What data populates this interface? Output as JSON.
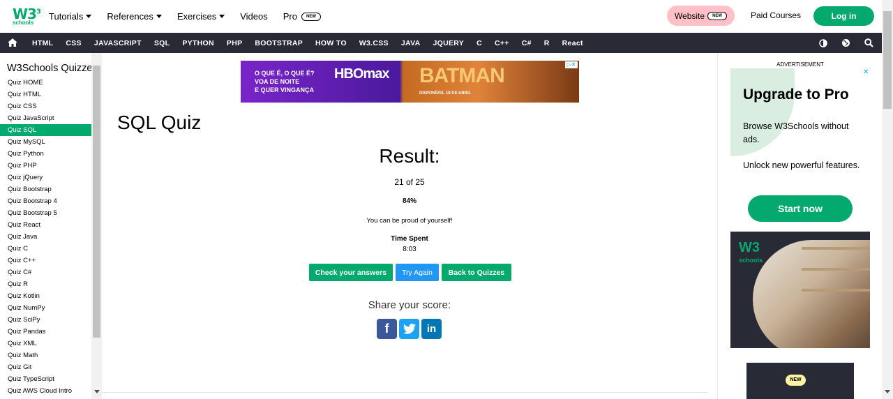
{
  "header": {
    "logo_text": "W3",
    "logo_sup": "3",
    "logo_sub": "schools",
    "nav": [
      {
        "label": "Tutorials",
        "dropdown": true
      },
      {
        "label": "References",
        "dropdown": true
      },
      {
        "label": "Exercises",
        "dropdown": true
      },
      {
        "label": "Videos",
        "dropdown": false
      },
      {
        "label": "Pro",
        "badge": "NEW"
      }
    ],
    "website_label": "Website",
    "website_badge": "NEW",
    "paid_courses": "Paid Courses",
    "login": "Log in"
  },
  "topics": [
    "HTML",
    "CSS",
    "JAVASCRIPT",
    "SQL",
    "PYTHON",
    "PHP",
    "BOOTSTRAP",
    "HOW TO",
    "W3.CSS",
    "JAVA",
    "JQUERY",
    "C",
    "C++",
    "C#",
    "R",
    "React"
  ],
  "sidebar": {
    "title": "W3Schools Quizzes",
    "items": [
      "Quiz HOME",
      "Quiz HTML",
      "Quiz CSS",
      "Quiz JavaScript",
      "Quiz SQL",
      "Quiz MySQL",
      "Quiz Python",
      "Quiz PHP",
      "Quiz jQuery",
      "Quiz Bootstrap",
      "Quiz Bootstrap 4",
      "Quiz Bootstrap 5",
      "Quiz React",
      "Quiz Java",
      "Quiz C",
      "Quiz C++",
      "Quiz C#",
      "Quiz R",
      "Quiz Kotlin",
      "Quiz NumPy",
      "Quiz SciPy",
      "Quiz Pandas",
      "Quiz XML",
      "Quiz Math",
      "Quiz Git",
      "Quiz TypeScript",
      "Quiz AWS Cloud Intro"
    ],
    "active_index": 4
  },
  "ad_banner": {
    "line1": "O QUE É, O QUE É?",
    "line2": "VOA DE NOITE",
    "line3": "E QUER VINGANÇA",
    "brand": "HBOmax",
    "movie": "BATMAN",
    "date": "DISPONÍVEL 18 DE ABRIL"
  },
  "main": {
    "title": "SQL Quiz",
    "result_heading": "Result:",
    "score": "21 of 25",
    "percent": "84%",
    "message": "You can be proud of yourself!",
    "time_label": "Time Spent",
    "time_value": "8:03",
    "buttons": {
      "check": "Check your answers",
      "retry": "Try Again",
      "back": "Back to Quizzes"
    },
    "share_label": "Share your score:"
  },
  "right_ad": {
    "label": "ADVERTISEMENT",
    "heading": "Upgrade to Pro",
    "p1": "Browse W3Schools without ads.",
    "p2": "Unlock new powerful features.",
    "cta": "Start now",
    "photo_logo": "W3",
    "photo_sub": "schools",
    "badge": "NEW"
  },
  "colors": {
    "brand_green": "#04aa6d",
    "nav_dark": "#282a35",
    "try_again_blue": "#2196f3",
    "website_pink": "#ffc0c7"
  }
}
